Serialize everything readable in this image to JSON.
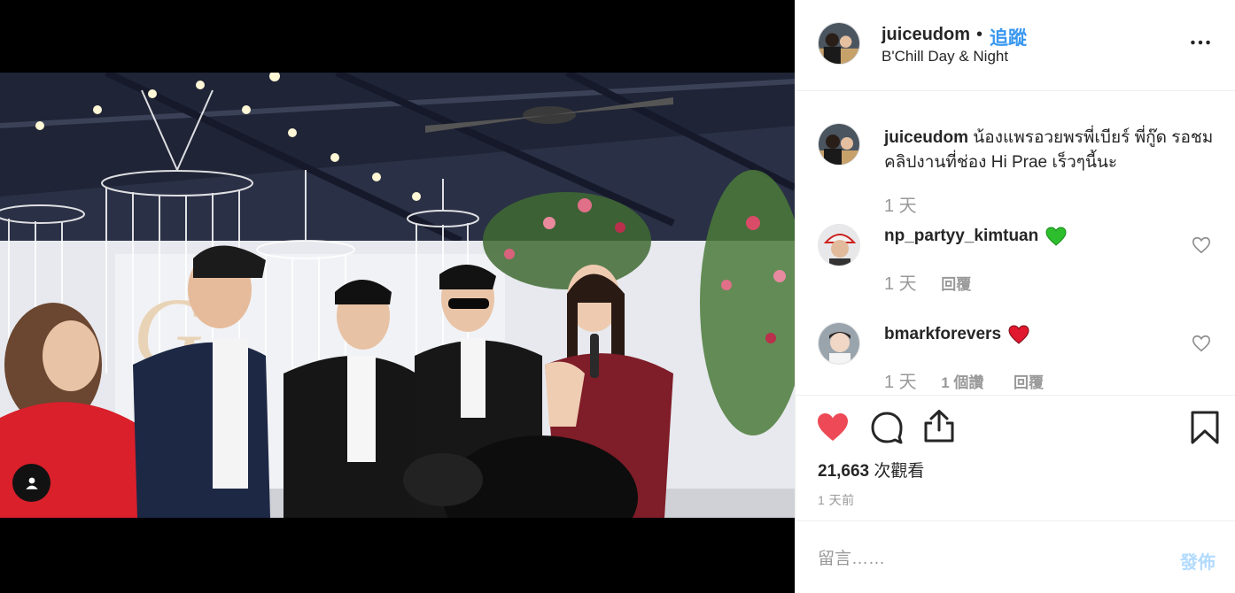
{
  "post": {
    "author": "juiceudom",
    "separator": "•",
    "follow_label": "追蹤",
    "location": "B'Chill Day & Night",
    "more_label": "•••"
  },
  "caption": {
    "username": "juiceudom",
    "text": "น้องแพรอวยพรพี่เบียร์ พี่กู๊ด รอชมคลิปงานที่ช่อง Hi Prae เร็วๆนี้นะ",
    "age": "1 天"
  },
  "comments": [
    {
      "username": "np_partyy_kimtuan",
      "emoji": "💚",
      "emoji_color": "#2dbe2d",
      "age": "1 天",
      "reply_label": "回覆"
    },
    {
      "username": "bmarkforevers",
      "emoji": "❤",
      "emoji_color": "#e0192e",
      "age": "1 天",
      "likes_label": "1 個讚",
      "reply_label": "回覆"
    }
  ],
  "actions": {
    "like_icon": "heart-filled-icon",
    "like_color": "#ed4956",
    "comment_icon": "comment-bubble-icon",
    "share_icon": "share-upload-icon",
    "save_icon": "bookmark-icon"
  },
  "views": {
    "count": "21,663",
    "label": "次觀看"
  },
  "timestamp": "1 天前",
  "add_comment": {
    "placeholder": "留言……",
    "post_label": "發佈"
  },
  "colors": {
    "link_blue": "#3897f0",
    "muted": "#999999",
    "post_disabled": "#b3dbff"
  }
}
